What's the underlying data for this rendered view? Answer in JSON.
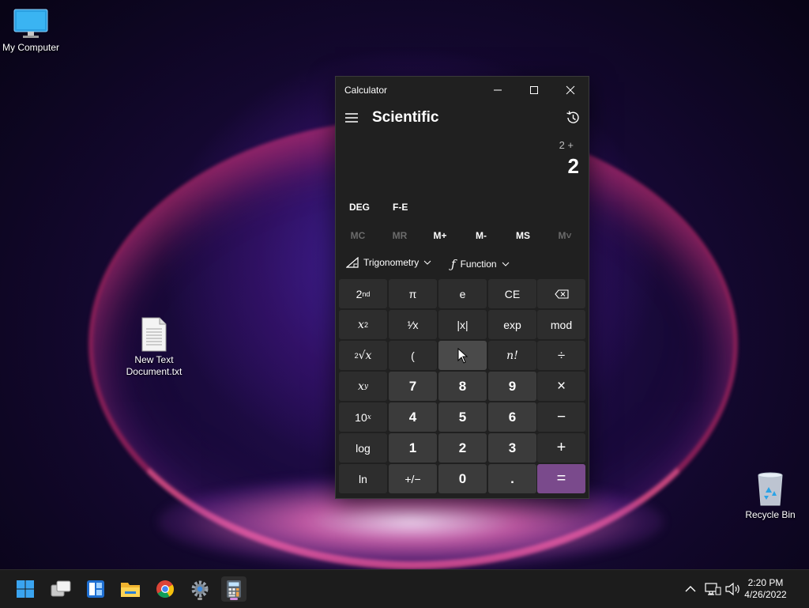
{
  "desktop": {
    "icons": [
      {
        "label": "My Computer"
      },
      {
        "label": "New Text Document.txt",
        "line1": "New Text",
        "line2": "Document.txt"
      },
      {
        "label": "Recycle Bin"
      }
    ]
  },
  "calculator": {
    "title": "Calculator",
    "mode": "Scientific",
    "expression": "2 +",
    "result": "2",
    "angle_unit": "DEG",
    "notation": "F-E",
    "memory": [
      "MC",
      "MR",
      "M+",
      "M-",
      "MS",
      "M˅"
    ],
    "menus": {
      "trig": "Trigonometry",
      "func": "Function"
    },
    "keys": [
      [
        "2nd",
        "π",
        "e",
        "CE",
        "backspace"
      ],
      [
        "x²",
        "¹⁄x",
        "|x|",
        "exp",
        "mod"
      ],
      [
        "²√x",
        "(",
        ")",
        "n!",
        "÷"
      ],
      [
        "xʸ",
        "7",
        "8",
        "9",
        "×"
      ],
      [
        "10ˣ",
        "4",
        "5",
        "6",
        "−"
      ],
      [
        "log",
        "1",
        "2",
        "3",
        "+"
      ],
      [
        "ln",
        "+/−",
        "0",
        ".",
        "="
      ]
    ]
  },
  "labels": {
    "k_2nd": "2",
    "k_2nd_sup": "nd",
    "k_pi": "π",
    "k_e": "e",
    "k_ce": "CE",
    "k_x": "x",
    "k_sq_sup": "2",
    "k_recip": "¹⁄x",
    "k_abs": "|x|",
    "k_exp": "exp",
    "k_mod": "mod",
    "k_root_sup": "2",
    "k_root": "√x",
    "k_lparen": "(",
    "k_rparen": ")",
    "k_fact": "n!",
    "k_div": "÷",
    "k_pow_sup": "y",
    "k_7": "7",
    "k_8": "8",
    "k_9": "9",
    "k_mul": "×",
    "k_ten": "10",
    "k_ten_sup": "x",
    "k_4": "4",
    "k_5": "5",
    "k_6": "6",
    "k_minus": "−",
    "k_log": "log",
    "k_1": "1",
    "k_2": "2",
    "k_3": "3",
    "k_plus": "+",
    "k_ln": "ln",
    "k_neg": "+/−",
    "k_0": "0",
    "k_dot": ".",
    "k_eq": "="
  },
  "taskbar": {
    "apps": [
      "start-icon",
      "task-view-icon",
      "widgets-icon",
      "file-explorer-icon",
      "chrome-icon",
      "settings-icon",
      "calculator-icon"
    ],
    "time": "2:20 PM",
    "date": "4/26/2022"
  },
  "colors": {
    "equals_accent": "#7a4a8c",
    "taskbar_indicator": "#d48ce0"
  }
}
